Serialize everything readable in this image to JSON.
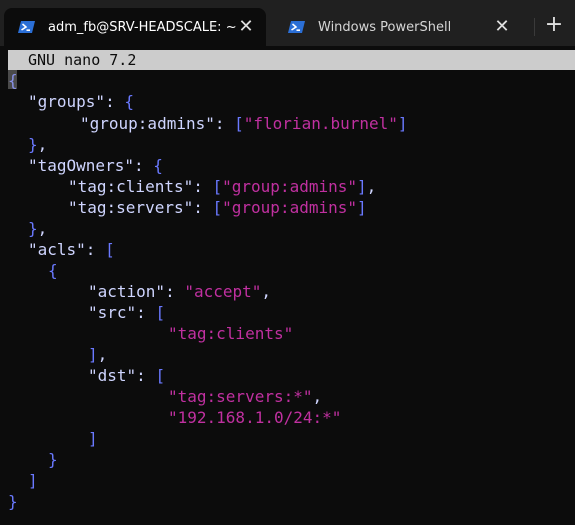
{
  "tabs": [
    {
      "title": "adm_fb@SRV-HEADSCALE: ~",
      "icon": "powershell-icon"
    },
    {
      "title": "Windows PowerShell",
      "icon": "powershell-icon"
    }
  ],
  "new_tab_label": "+",
  "close_label": "✕",
  "nano": {
    "title": "GNU nano 7.2"
  },
  "code": {
    "groups_key": "\"groups\"",
    "group_admins_key": "\"group:admins\"",
    "group_admins_value": "\"florian.burnel\"",
    "tagowners_key": "\"tagOwners\"",
    "tag_clients_key": "\"tag:clients\"",
    "tag_clients_value": "\"group:admins\"",
    "tag_servers_key": "\"tag:servers\"",
    "tag_servers_value": "\"group:admins\"",
    "acls_key": "\"acls\"",
    "action_key": "\"action\"",
    "action_value": "\"accept\"",
    "src_key": "\"src\"",
    "src_value": "\"tag:clients\"",
    "dst_key": "\"dst\"",
    "dst_value_1": "\"tag:servers:*\"",
    "dst_value_2": "\"192.168.1.0/24:*\""
  },
  "colors": {
    "key": "#cfd5ff",
    "string": "#c030a0",
    "punctuation": "#6a79ff"
  }
}
